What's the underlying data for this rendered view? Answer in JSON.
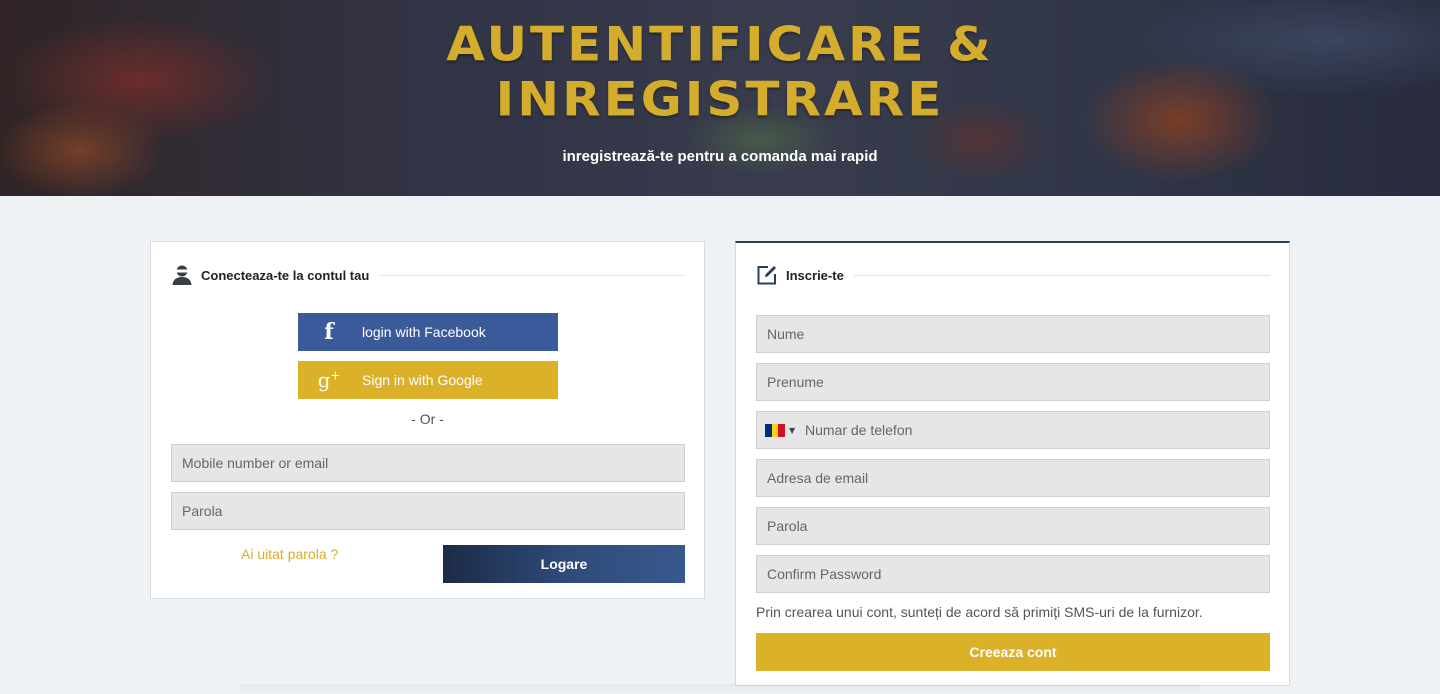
{
  "hero": {
    "title_line1": "AUTENTIFICARE &",
    "title_line2": "INREGISTRARE",
    "subtitle": "inregistrează-te pentru a comanda mai rapid"
  },
  "login": {
    "heading": "Conecteaza-te la contul tau",
    "facebook_label": "login with Facebook",
    "google_label": "Sign in with Google",
    "or_text": "- Or -",
    "identity_placeholder": "Mobile number or email",
    "password_placeholder": "Parola",
    "forgot_label": "Ai uitat parola ?",
    "submit_label": "Logare"
  },
  "signup": {
    "heading": "Inscrie-te",
    "first_name_placeholder": "Nume",
    "last_name_placeholder": "Prenume",
    "phone_placeholder": "Numar de telefon",
    "phone_country": "RO",
    "email_placeholder": "Adresa de email",
    "password_placeholder": "Parola",
    "confirm_placeholder": "Confirm Password",
    "terms_text": "Prin crearea unui cont, sunteți de acord să primiți SMS-uri de la furnizor.",
    "submit_label": "Creeaza cont"
  },
  "icons": {
    "login_heading": "user-icon",
    "signup_heading": "edit-icon",
    "facebook": "facebook-icon",
    "google": "google-plus-icon",
    "flag": "romania-flag-icon"
  },
  "colors": {
    "gold": "#dcb12a",
    "facebook": "#3b5a9a",
    "navy": "#2a3f5f",
    "background": "#eef2f5",
    "field": "#e6e6e6"
  }
}
